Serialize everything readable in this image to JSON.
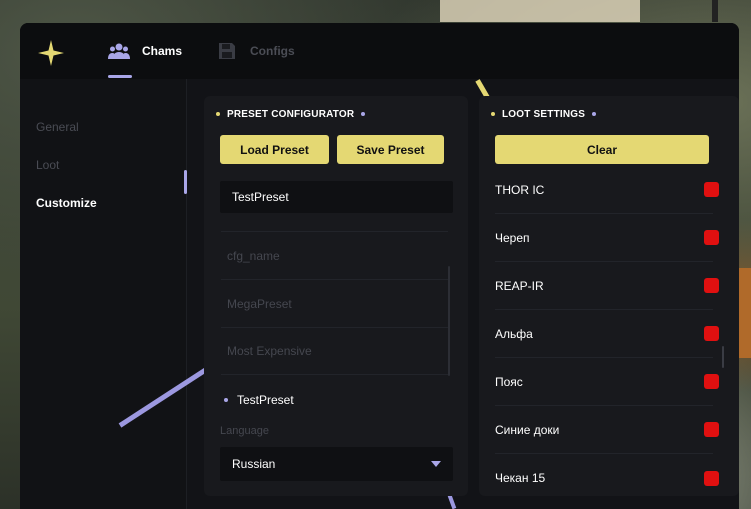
{
  "tabs": [
    {
      "label": "Chams",
      "icon": "users-icon",
      "active": true
    },
    {
      "label": "Configs",
      "icon": "floppy-disk-icon",
      "active": false
    }
  ],
  "sidebar": {
    "items": [
      {
        "label": "General",
        "active": false
      },
      {
        "label": "Loot",
        "active": false
      },
      {
        "label": "Customize",
        "active": true
      }
    ]
  },
  "preset": {
    "title": "PRESET CONFIGURATOR",
    "load_label": "Load Preset",
    "save_label": "Save Preset",
    "name_value": "TestPreset",
    "list": [
      "cfg_name",
      "MegaPreset",
      "Most Expensive"
    ],
    "selected": "TestPreset",
    "language_label": "Language",
    "language_value": "Russian"
  },
  "loot": {
    "title": "LOOT SETTINGS",
    "clear_label": "Clear",
    "items": [
      {
        "label": "THOR IC",
        "checked": true
      },
      {
        "label": "Череп",
        "checked": true
      },
      {
        "label": "REAP-IR",
        "checked": true
      },
      {
        "label": "Альфа",
        "checked": true
      },
      {
        "label": "Пояс",
        "checked": true
      },
      {
        "label": "Синие доки",
        "checked": true
      },
      {
        "label": "Чекан 15",
        "checked": true
      }
    ]
  },
  "colors": {
    "accent_yellow": "#e4d873",
    "accent_purple": "#a9a6e8",
    "checkbox_red": "#e01010"
  }
}
